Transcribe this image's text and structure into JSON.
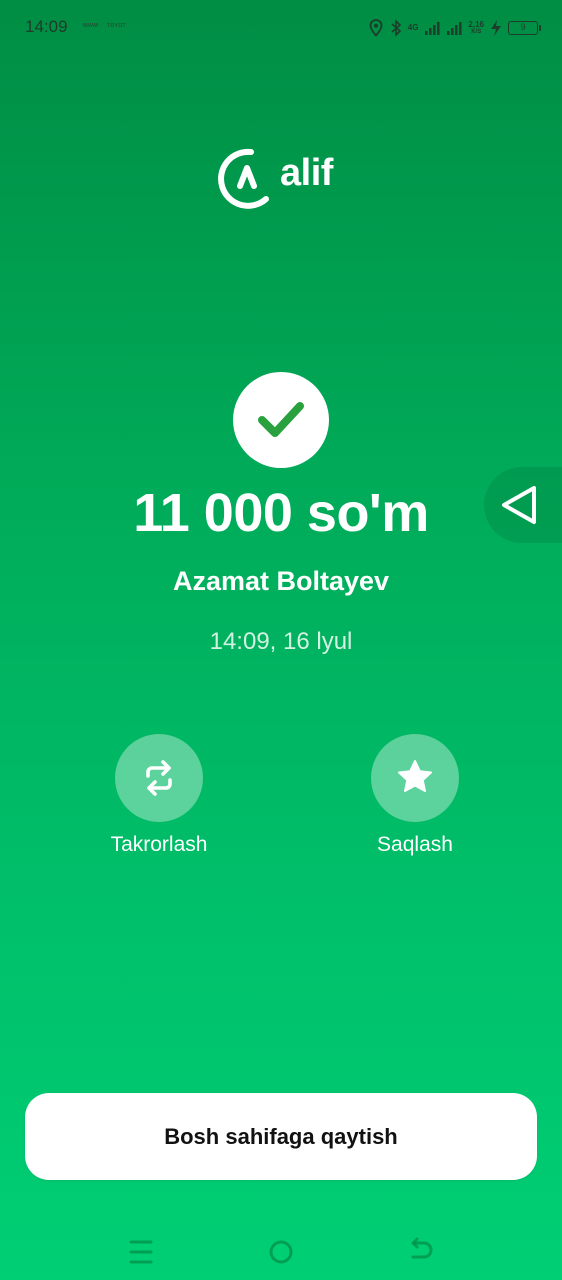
{
  "status_bar": {
    "time": "14:09",
    "mini_labels": [
      "ᴍᴡᴍ",
      "ᴛᴏʏᴏᴛ"
    ],
    "network": "4G",
    "speed_value": "2,16",
    "speed_unit": "K/S",
    "battery": "9"
  },
  "brand": {
    "name": "alif",
    "icon": "alif-logo-icon"
  },
  "payment": {
    "status_icon": "checkmark-icon",
    "amount": "11 000 so'm",
    "recipient": "Azamat Boltayev",
    "datetime": "14:09, 16 lyul"
  },
  "actions": [
    {
      "label": "Takrorlash",
      "icon": "repeat-icon"
    },
    {
      "label": "Saqlash",
      "icon": "star-icon"
    }
  ],
  "home_button": {
    "label": "Bosh sahifaga qaytish"
  },
  "floating_button": {
    "icon": "back-triangle-icon"
  },
  "navigation": {
    "items": [
      "menu-icon",
      "home-icon",
      "back-icon"
    ]
  },
  "colors": {
    "gradient_top": "#008d44",
    "gradient_bottom": "#00cf74",
    "check_green": "#2aa13f"
  }
}
